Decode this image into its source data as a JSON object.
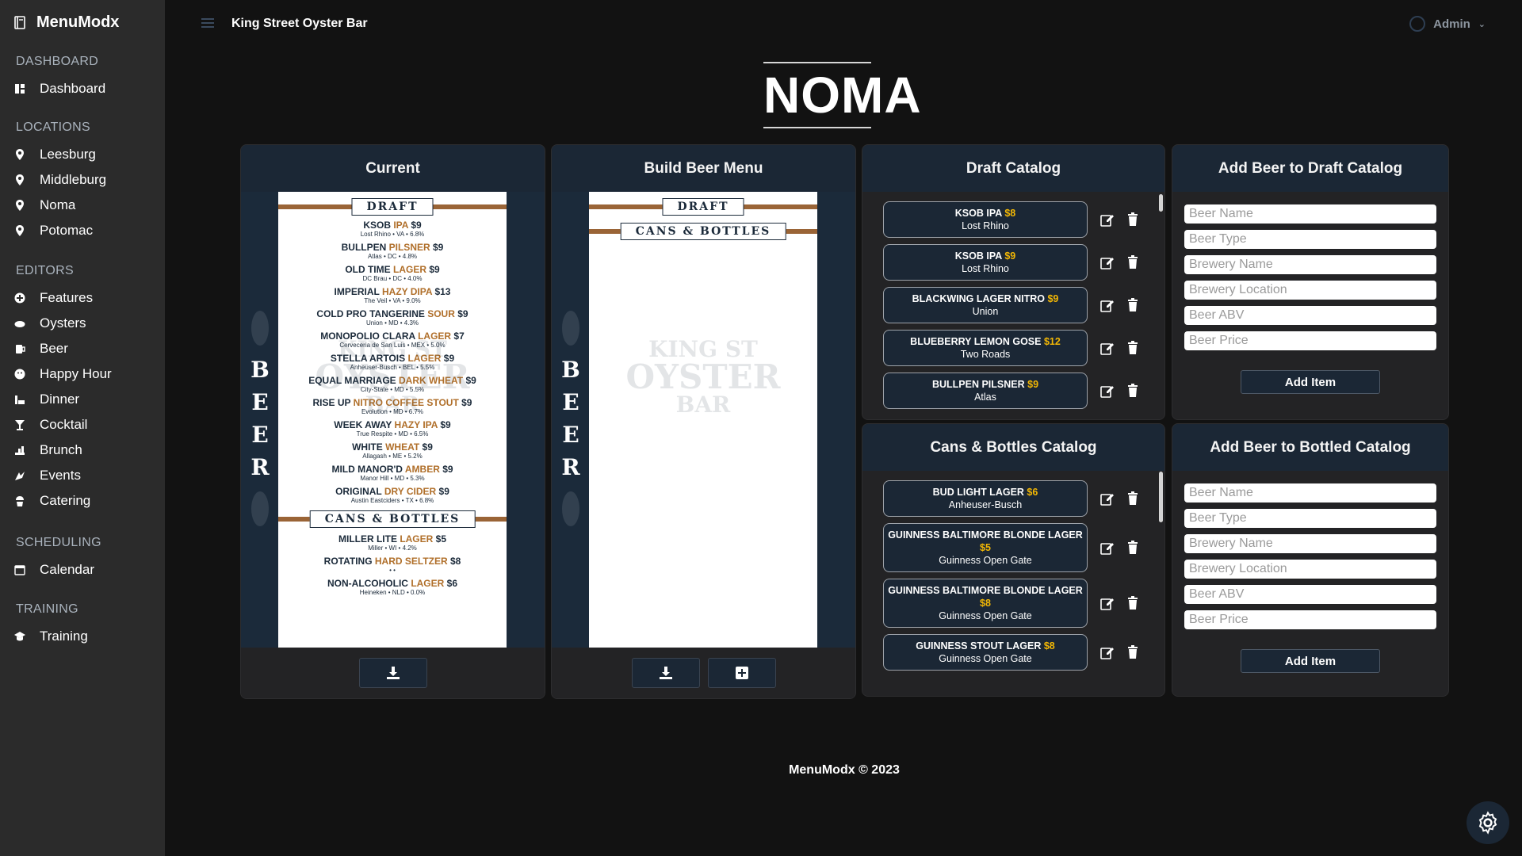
{
  "app": {
    "name": "MenuModx",
    "location_title": "King Street Oyster Bar",
    "user": "Admin"
  },
  "sidebar": {
    "sections": [
      {
        "title": "DASHBOARD",
        "items": [
          {
            "label": "Dashboard",
            "icon": "dashboard-icon"
          }
        ]
      },
      {
        "title": "LOCATIONS",
        "items": [
          {
            "label": "Leesburg",
            "icon": "map-pin-icon"
          },
          {
            "label": "Middleburg",
            "icon": "map-pin-icon"
          },
          {
            "label": "Noma",
            "icon": "map-pin-icon"
          },
          {
            "label": "Potomac",
            "icon": "map-pin-icon"
          }
        ]
      },
      {
        "title": "EDITORS",
        "items": [
          {
            "label": "Features",
            "icon": "plus-circle-icon"
          },
          {
            "label": "Oysters",
            "icon": "oyster-icon"
          },
          {
            "label": "Beer",
            "icon": "beer-icon"
          },
          {
            "label": "Happy Hour",
            "icon": "smile-icon"
          },
          {
            "label": "Dinner",
            "icon": "dinner-icon"
          },
          {
            "label": "Cocktail",
            "icon": "cocktail-icon"
          },
          {
            "label": "Brunch",
            "icon": "brunch-icon"
          },
          {
            "label": "Events",
            "icon": "events-icon"
          },
          {
            "label": "Catering",
            "icon": "catering-icon"
          }
        ]
      },
      {
        "title": "SCHEDULING",
        "items": [
          {
            "label": "Calendar",
            "icon": "calendar-icon"
          }
        ]
      },
      {
        "title": "TRAINING",
        "items": [
          {
            "label": "Training",
            "icon": "graduation-cap-icon"
          }
        ]
      }
    ]
  },
  "page": {
    "title": "NOMA"
  },
  "current": {
    "title": "Current",
    "vertical_word": [
      "B",
      "E",
      "E",
      "R"
    ],
    "draft_label": "DRAFT",
    "cans_label": "CANS & BOTTLES",
    "watermark": {
      "l1": "KING ST",
      "l2": "OYSTER",
      "l3": "BAR"
    },
    "draft_items": [
      {
        "pre": "KSOB ",
        "type": "IPA",
        "post": " $9",
        "sub": "Lost Rhino • VA • 6.8%"
      },
      {
        "pre": "BULLPEN ",
        "type": "PILSNER",
        "post": " $9",
        "sub": "Atlas • DC • 4.8%"
      },
      {
        "pre": "OLD TIME ",
        "type": "LAGER",
        "post": " $9",
        "sub": "DC Brau • DC • 4.0%"
      },
      {
        "pre": "IMPERIAL ",
        "type": "HAZY DIPA",
        "post": " $13",
        "sub": "The Veil • VA • 9.0%"
      },
      {
        "pre": "COLD PRO TANGERINE ",
        "type": "SOUR",
        "post": " $9",
        "sub": "Union • MD • 4.3%"
      },
      {
        "pre": "MONOPOLIO CLARA ",
        "type": "LAGER",
        "post": " $7",
        "sub": "Cerveceria de San Luis • MEX • 5.0%"
      },
      {
        "pre": "STELLA ARTOIS ",
        "type": "LAGER",
        "post": " $9",
        "sub": "Anheuser-Busch • BEL • 5.5%"
      },
      {
        "pre": "EQUAL MARRIAGE ",
        "type": "DARK WHEAT",
        "post": " $9",
        "sub": "City-State • MD • 5.5%"
      },
      {
        "pre": "RISE UP ",
        "type": "NITRO COFFEE STOUT",
        "post": " $9",
        "sub": "Evolution • MD • 6.7%"
      },
      {
        "pre": "WEEK AWAY ",
        "type": "HAZY IPA",
        "post": " $9",
        "sub": "True Respite • MD • 6.5%"
      },
      {
        "pre": "WHITE ",
        "type": "WHEAT",
        "post": " $9",
        "sub": "Allagash • ME • 5.2%"
      },
      {
        "pre": "MILD MANOR'D ",
        "type": "AMBER",
        "post": " $9",
        "sub": "Manor Hill • MD • 5.3%"
      },
      {
        "pre": "ORIGINAL ",
        "type": "DRY CIDER",
        "post": " $9",
        "sub": "Austin Eastciders • TX • 6.8%"
      }
    ],
    "cans_items": [
      {
        "pre": "MILLER LITE ",
        "type": "LAGER",
        "post": " $5",
        "sub": "Miller • WI • 4.2%"
      },
      {
        "pre": "ROTATING ",
        "type": "HARD SELTZER",
        "post": " $8",
        "sub": "• •"
      },
      {
        "pre": "NON-ALCOHOLIC ",
        "type": "LAGER",
        "post": " $6",
        "sub": "Heineken • NLD • 0.0%"
      }
    ]
  },
  "build": {
    "title": "Build Beer Menu",
    "draft_label": "DRAFT",
    "cans_label": "CANS & BOTTLES"
  },
  "draft_catalog": {
    "title": "Draft Catalog",
    "items": [
      {
        "name": "KSOB IPA",
        "price": "$8",
        "brewery": "Lost Rhino"
      },
      {
        "name": "KSOB IPA",
        "price": "$9",
        "brewery": "Lost Rhino"
      },
      {
        "name": "BLACKWING LAGER NITRO",
        "price": "$9",
        "brewery": "Union"
      },
      {
        "name": "BLUEBERRY LEMON GOSE",
        "price": "$12",
        "brewery": "Two Roads"
      },
      {
        "name": "BULLPEN PILSNER",
        "price": "$9",
        "brewery": "Atlas"
      }
    ]
  },
  "bottled_catalog": {
    "title": "Cans & Bottles Catalog",
    "items": [
      {
        "name": "BUD LIGHT LAGER",
        "price": "$6",
        "brewery": "Anheuser-Busch"
      },
      {
        "name": "GUINNESS BALTIMORE BLONDE LAGER",
        "price": "$5",
        "brewery": "Guinness Open Gate"
      },
      {
        "name": "GUINNESS BALTIMORE BLONDE LAGER",
        "price": "$8",
        "brewery": "Guinness Open Gate"
      },
      {
        "name": "GUINNESS STOUT LAGER",
        "price": "$8",
        "brewery": "Guinness Open Gate"
      }
    ]
  },
  "add_draft": {
    "title": "Add Beer to Draft Catalog",
    "placeholders": [
      "Beer Name",
      "Beer Type",
      "Brewery Name",
      "Brewery Location",
      "Beer ABV",
      "Beer Price"
    ],
    "button": "Add Item"
  },
  "add_bottled": {
    "title": "Add Beer to Bottled Catalog",
    "placeholders": [
      "Beer Name",
      "Beer Type",
      "Brewery Name",
      "Brewery Location",
      "Beer ABV",
      "Beer Price"
    ],
    "button": "Add Item"
  },
  "footer": "MenuModx © 2023",
  "colors": {
    "accent_navy": "#1b2735",
    "price_yellow": "#f2b705",
    "menu_copper": "#9a6436"
  }
}
